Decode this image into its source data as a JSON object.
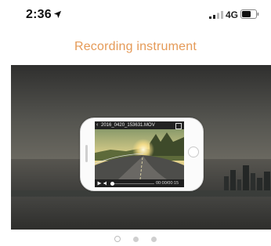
{
  "status_bar": {
    "time": "2:36",
    "network": "4G",
    "icons": [
      "location-arrow-icon",
      "signal-icon",
      "battery-icon"
    ]
  },
  "header": {
    "title": "Recording instrument",
    "title_color": "#e59a57"
  },
  "player": {
    "filename": "2016_0420_153631.MOV",
    "time": "00:00/00:15",
    "back_icon": "chevron-left-icon",
    "fullscreen_icon": "fullscreen-icon",
    "play_icon": "play-icon",
    "volume_icon": "volume-icon",
    "progress": 0.05
  },
  "pager": {
    "count": 3,
    "active_index": 0
  }
}
